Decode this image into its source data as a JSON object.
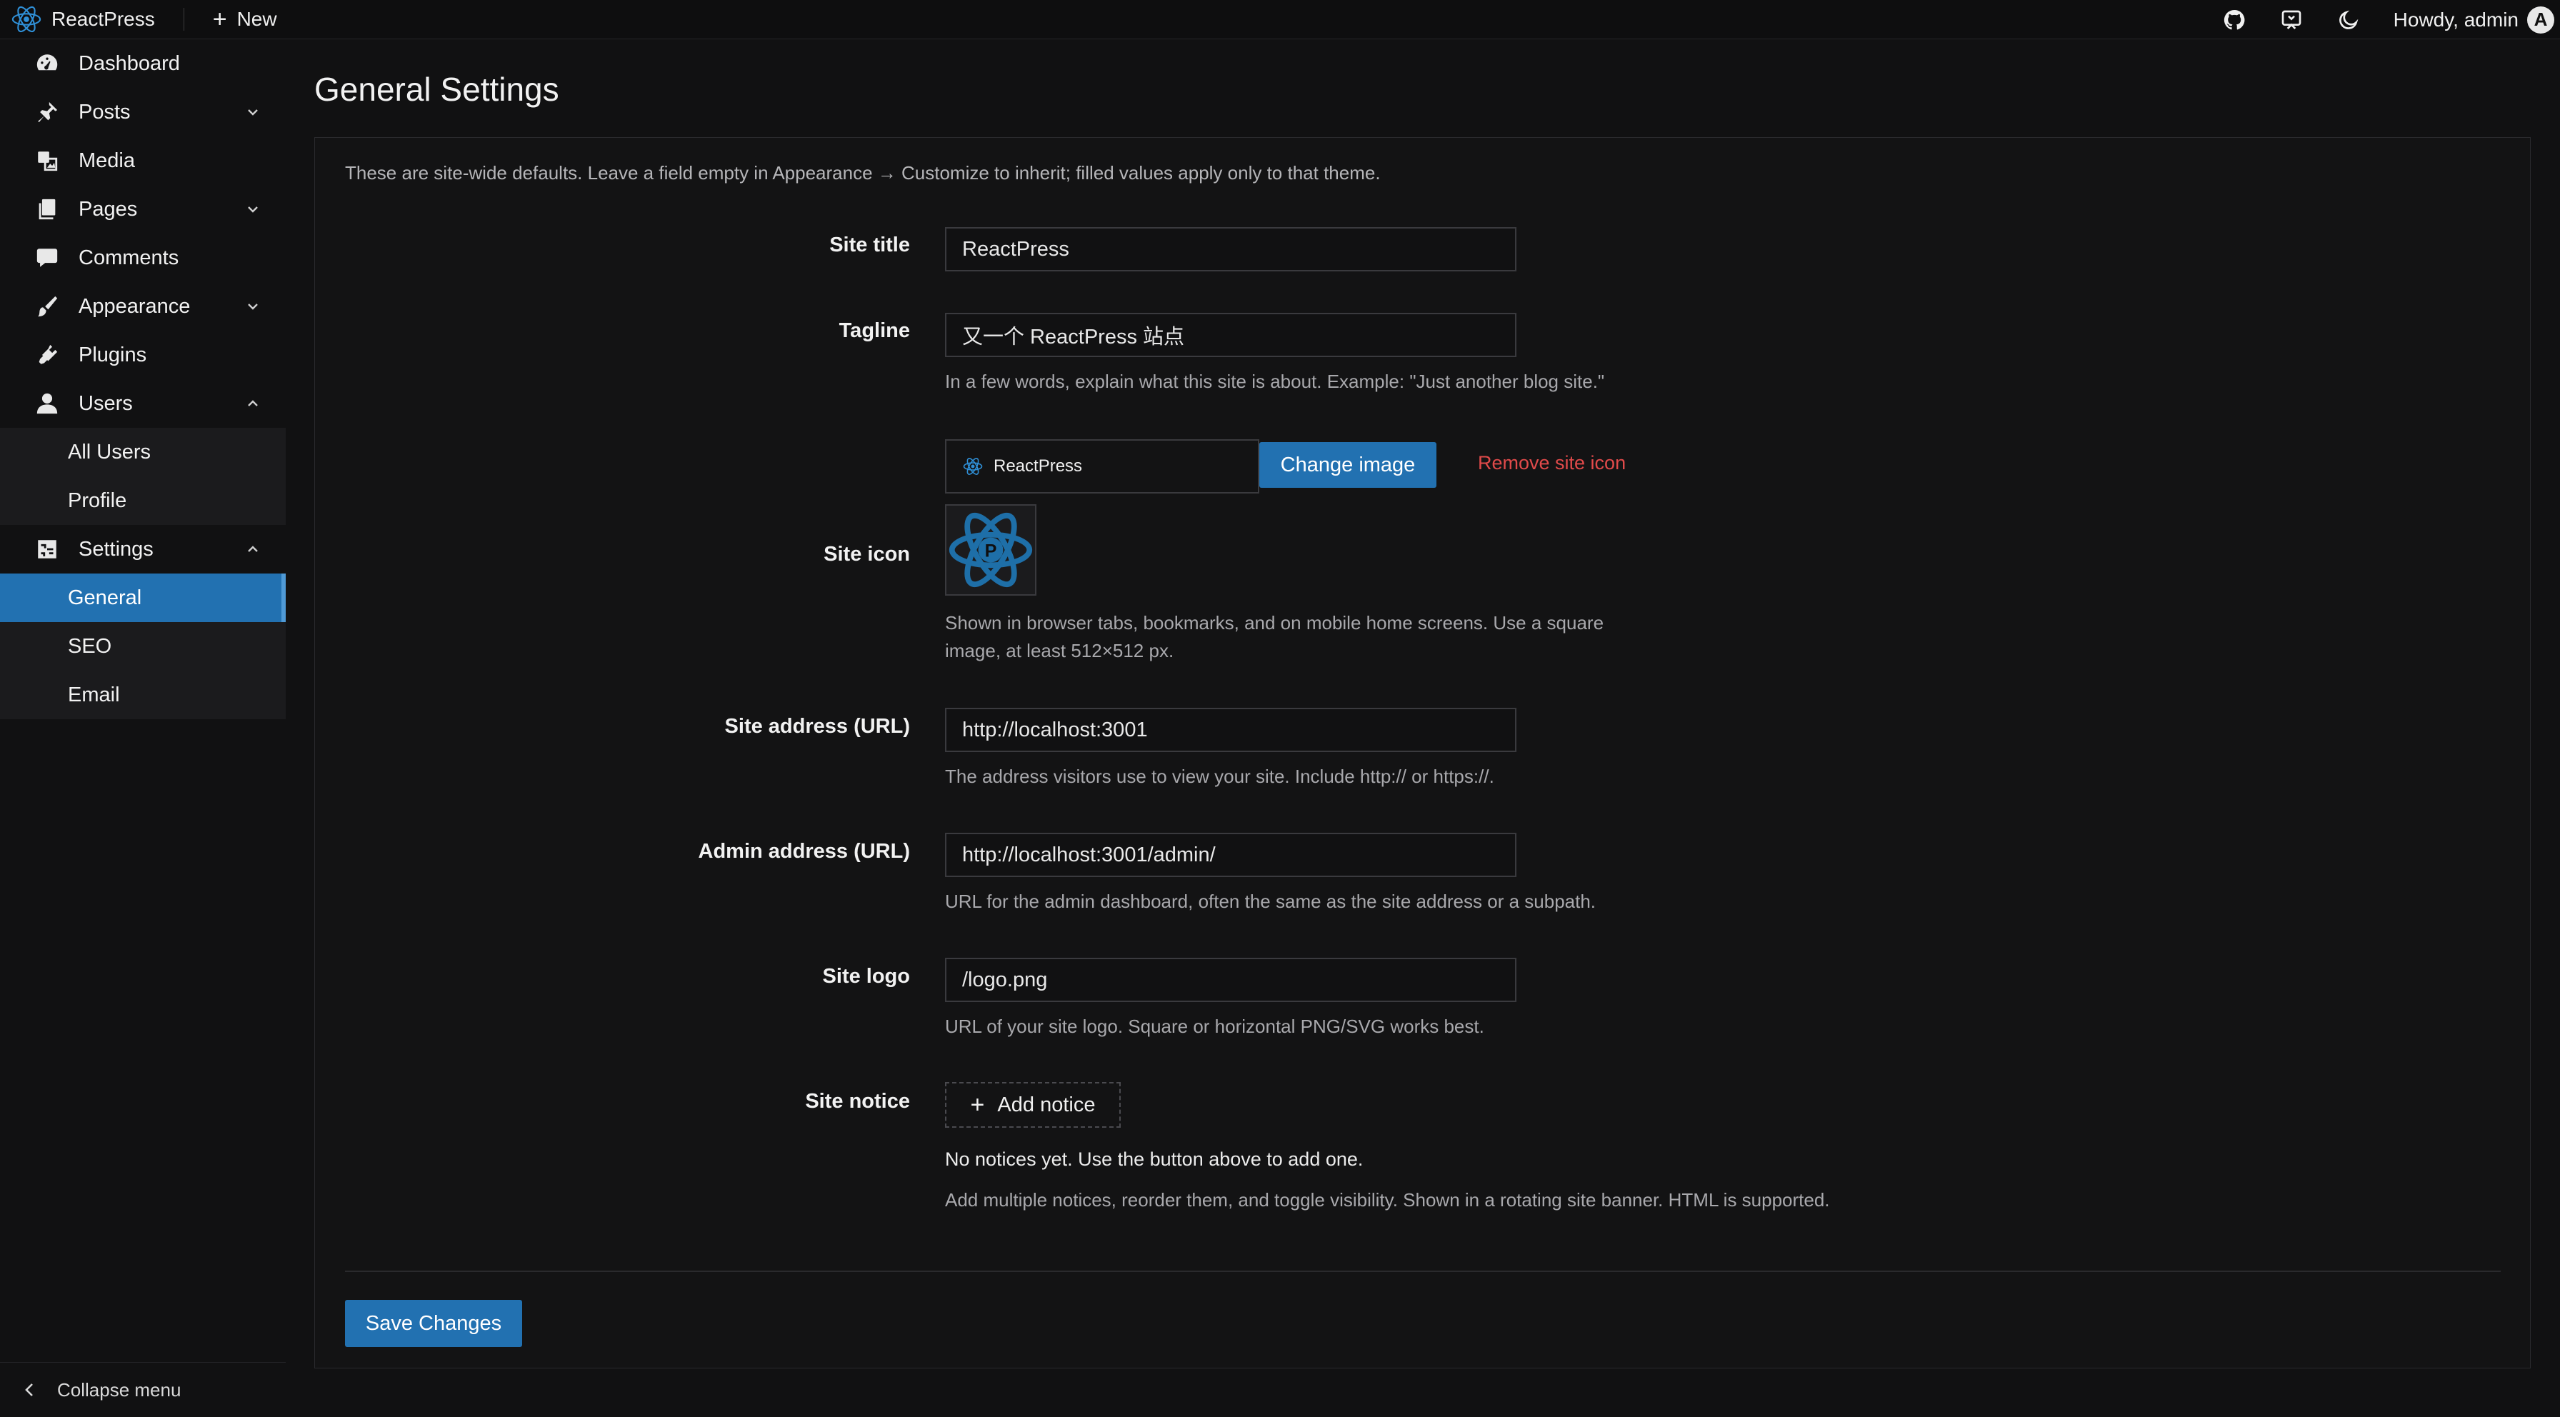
{
  "topbar": {
    "brand": "ReactPress",
    "new_label": "New",
    "howdy": "Howdy, admin",
    "avatar_letter": "A",
    "icons": [
      "github-icon",
      "preview-icon",
      "moon-icon"
    ]
  },
  "sidebar": {
    "items": [
      {
        "label": "Dashboard",
        "icon": "dashboard-icon"
      },
      {
        "label": "Posts",
        "icon": "pin-icon",
        "chevron": "down"
      },
      {
        "label": "Media",
        "icon": "media-icon"
      },
      {
        "label": "Pages",
        "icon": "pages-icon",
        "chevron": "down"
      },
      {
        "label": "Comments",
        "icon": "comment-icon"
      },
      {
        "label": "Appearance",
        "icon": "brush-icon",
        "chevron": "down"
      },
      {
        "label": "Plugins",
        "icon": "plugin-icon"
      },
      {
        "label": "Users",
        "icon": "user-icon",
        "chevron": "up"
      },
      {
        "label": "Settings",
        "icon": "settings-icon",
        "chevron": "up"
      }
    ],
    "users_sub": [
      "All Users",
      "Profile"
    ],
    "settings_sub": [
      "General",
      "SEO",
      "Email"
    ],
    "active": "General",
    "collapse_label": "Collapse menu"
  },
  "page": {
    "title": "General Settings",
    "intro": "These are site-wide defaults. Leave a field empty in Appearance → Customize to inherit; filled values apply only to that theme."
  },
  "form": {
    "site_title": {
      "label": "Site title",
      "value": "ReactPress"
    },
    "tagline": {
      "label": "Tagline",
      "value": "又一个 ReactPress 站点",
      "help": "In a few words, explain what this site is about. Example: \"Just another blog site.\""
    },
    "site_icon": {
      "label": "Site icon",
      "preview_name": "ReactPress",
      "change_label": "Change image",
      "remove_label": "Remove site icon",
      "help_line1": "Shown in browser tabs, bookmarks, and on mobile home screens. Use a square",
      "help_line2": "image, at least 512×512 px."
    },
    "site_address": {
      "label": "Site address (URL)",
      "value": "http://localhost:3001",
      "help": "The address visitors use to view your site. Include http:// or https://."
    },
    "admin_address": {
      "label": "Admin address (URL)",
      "value": "http://localhost:3001/admin/",
      "help": "URL for the admin dashboard, often the same as the site address or a subpath."
    },
    "site_logo": {
      "label": "Site logo",
      "value": "/logo.png",
      "help": "URL of your site logo. Square or horizontal PNG/SVG works best."
    },
    "site_notice": {
      "label": "Site notice",
      "add_label": "Add notice",
      "empty": "No notices yet. Use the button above to add one.",
      "help": "Add multiple notices, reorder them, and toggle visibility. Shown in a rotating site banner. HTML is supported."
    },
    "save_label": "Save Changes"
  },
  "colors": {
    "accent": "#2271b1",
    "danger": "#e04a4a",
    "brand": "#2f8fd6"
  }
}
